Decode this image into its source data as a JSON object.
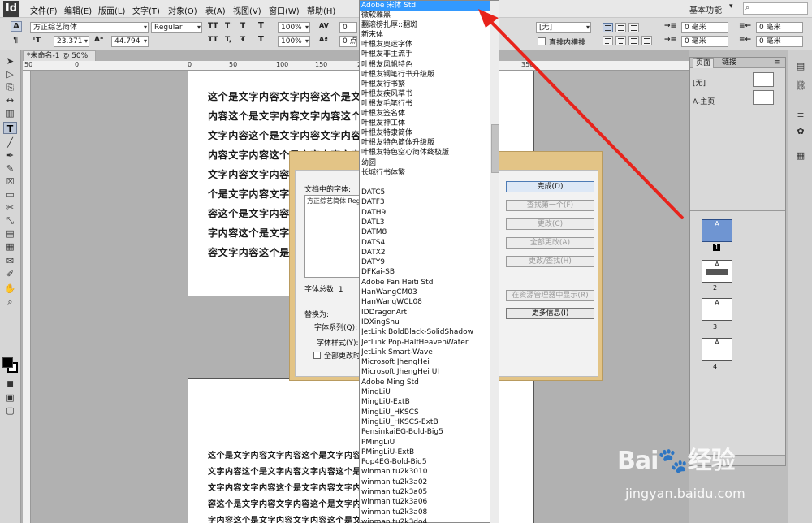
{
  "app": {
    "logo": "Id"
  },
  "menu": [
    "文件(F)",
    "编辑(E)",
    "版面(L)",
    "文字(T)",
    "对象(O)",
    "表(A)",
    "视图(V)",
    "窗口(W)",
    "帮助(H)"
  ],
  "workspace": {
    "label": "基本功能",
    "caret": "▾"
  },
  "help_search": {
    "placeholder": "",
    "icon": "search-icon"
  },
  "control": {
    "font_family": "方正综艺简体",
    "font_style": "Regular",
    "font_size": "23.371",
    "leading": "44.794",
    "h_scale": "100%",
    "v_scale": "100%",
    "tracking": "0",
    "kerning": "0",
    "baseline": "0 点",
    "char_style": "[无]",
    "checkbox_label": "直排内横排",
    "mm1": "0 毫米",
    "mm2": "0 毫米",
    "mm3": "0 毫米",
    "mm4": "0 毫米",
    "caps1": "TT",
    "caps2": "T'",
    "caps3": "T",
    "caps4": "T,",
    "caps5": "T",
    "caps6": "Ŧ"
  },
  "document_tab": "*未命名-1 @ 50%",
  "ruler": {
    "ticks": [
      "50",
      "0",
      "50",
      "100",
      "150",
      "200",
      "250",
      "300",
      "350"
    ]
  },
  "page1_lines": [
    "这个是文字内容文字内容这个是文",
    "内容这个是文字内容文字内容这个",
    "文字内容这个是文字内容文字内容",
    "内容文字内容这个是文字内容文字",
    "文字内容文字内容这个",
    "个是文字内容文字内容",
    "容这个是文字内容文字",
    "字内容这个是文字内容",
    "容文字内容这个是文字"
  ],
  "page2_lines": [
    "这个是文字内容文字内容这个是文字内容文字内容这个是文字内容文字",
    "文字内容这个是文字内容文字内容这个是文字内容文字内容这个是文字",
    "文字内容文字内容这个是文字内容文字内容这个是文字内容文字内容这",
    "容这个是文字内容文字内容这个是文字内容文字内容这个是文字内容文",
    "字内容这个是文字内容文字内容这个是文字内容文字内容这个是文字内"
  ],
  "dialog": {
    "label_fonts_in_doc": "文档中的字体:",
    "fonts": [
      "方正综艺简体 Regular"
    ],
    "total_label": "字体总数: 1",
    "replace_label": "替换为:",
    "family_label": "字体系列(Q):",
    "style_label": "字体样式(Y):",
    "change_all_label": "全部更改时",
    "buttons": [
      {
        "label": "完成(D)",
        "state": "primary"
      },
      {
        "label": "查找第一个(F)",
        "state": "disabled"
      },
      {
        "label": "更改(C)",
        "state": "disabled"
      },
      {
        "label": "全部更改(A)",
        "state": "disabled"
      },
      {
        "label": "更改/查找(H)",
        "state": "disabled"
      },
      {
        "label": "在资源管理器中显示(R)",
        "state": "disabled"
      },
      {
        "label": "更多信息(I)",
        "state": "enabled"
      }
    ]
  },
  "font_dropdown": {
    "selected": "Adobe 宋体 Std",
    "group1": [
      "微软雅黑",
      "翻滚榜扎厚::翻斑",
      "新宋体",
      "叶根友奥运字体",
      "叶根友非主流手",
      "叶根友风帆特色",
      "叶根友钢笔行书升级版",
      "叶根友行书繁",
      "叶根友疾风草书",
      "叶根友毛笔行书",
      "叶根友签名体",
      "叶根友神工体",
      "叶根友特隶简体",
      "叶根友特色简体升级版",
      "叶根友特色空心简体终极版",
      "幼圆",
      "长城行书体繁"
    ],
    "group2": [
      "DATC5",
      "DATF3",
      "DATH9",
      "DATL3",
      "DATM8",
      "DATS4",
      "DATX2",
      "DATY9",
      "DFKai-SB",
      "Adobe Fan Heiti Std",
      "HanWangCM03",
      "HanWangWCL08",
      "IDDragonArt",
      "IDXingShu",
      "JetLink BoldBlack-SolidShadow",
      "JetLink Pop-HalfHeavenWater",
      "JetLink Smart-Wave",
      "Microsoft JhengHei",
      "Microsoft JhengHei UI",
      "Adobe Ming Std",
      "MingLiU",
      "MingLiU-ExtB",
      "MingLiU_HKSCS",
      "MingLiU_HKSCS-ExtB",
      "PensinkaiEG-Bold-Big5",
      "PMingLiU",
      "PMingLiU-ExtB",
      "Pop4EG-Bold-Big5",
      "winman tu2k3010",
      "winman tu2k3a02",
      "winman tu2k3a05",
      "winman tu2k3a06",
      "winman tu2k3a08",
      "winman tu2k3do4"
    ]
  },
  "pages_panel": {
    "tabs": [
      "页面",
      "链接"
    ],
    "masters": [
      "[无]",
      "A-主页"
    ],
    "pages": [
      {
        "num": "1",
        "master": "A"
      },
      {
        "num": "2",
        "master": "A"
      },
      {
        "num": "3",
        "master": "A"
      },
      {
        "num": "4",
        "master": "A"
      }
    ]
  },
  "watermark": {
    "logo": "Bai",
    "logo2": "经验",
    "url": "jingyan.baidu.com"
  },
  "colors": {
    "selection": "#3399ff",
    "dialog_frame": "#e3c486",
    "arrow": "#e8231b"
  }
}
